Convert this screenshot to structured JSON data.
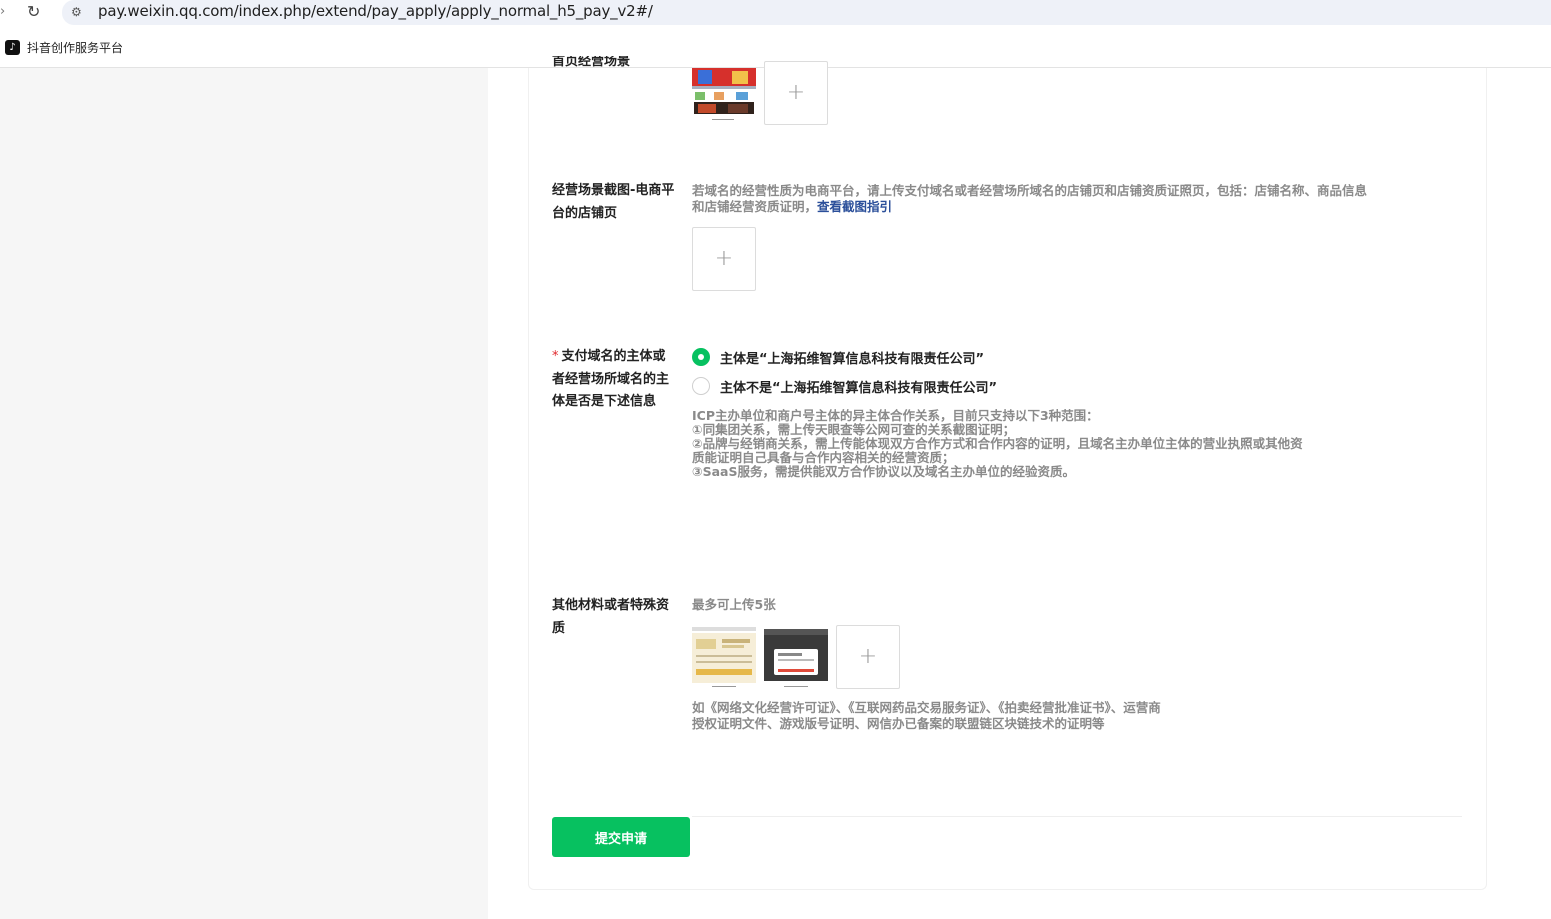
{
  "browser": {
    "url": "pay.weixin.qq.com/index.php/extend/pay_apply/apply_normal_h5_pay_v2#/",
    "bookmark": "抖音创作服务平台"
  },
  "form": {
    "top_row": {
      "label": "首页经营场景"
    },
    "shop_page": {
      "label": "经营场景截图-电商平台的店铺页",
      "hint_text": "若域名的经营性质为电商平台，请上传支付域名或者经营场所域名的店铺页和店铺资质证照页，包括：店铺名称、商品信息和店铺经营资质证明，",
      "hint_link": "查看截图指引"
    },
    "subject": {
      "required_mark": "*",
      "label": "支付域名的主体或者经营场所域名的主体是否是下述信息",
      "options": [
        {
          "label": "主体是“上海拓维智算信息科技有限责任公司”",
          "checked": true
        },
        {
          "label": "主体不是“上海拓维智算信息科技有限责任公司”",
          "checked": false
        }
      ],
      "note_lines": [
        "ICP主办单位和商户号主体的异主体合作关系，目前只支持以下3种范围：",
        "①同集团关系，需上传天眼查等公网可查的关系截图证明；",
        "②品牌与经销商关系，需上传能体现双方合作方式和合作内容的证明，且域名主办单位主体的营业执照或其他资",
        "质能证明自己具备与合作内容相关的经营资质；",
        "③SaaS服务，需提供能双方合作协议以及域名主办单位的经验资质。"
      ]
    },
    "other": {
      "label": "其他材料或者特殊资质",
      "limit_hint": "最多可上传5张",
      "note_lines": [
        "如《网络文化经营许可证》、《互联网药品交易服务证》、《拍卖经营批准证书》、运营商",
        "授权证明文件、游戏版号证明、网信办已备案的联盟链区块链技术的证明等"
      ]
    },
    "upload_plus": "+",
    "submit_label": "提交申请"
  },
  "colors": {
    "primary": "#07c160",
    "link": "#2b4f9a",
    "required": "#e0282c",
    "left_background": "#f6f6f6"
  },
  "icons": [
    "back-arrow-icon",
    "reload-icon",
    "site-info-icon",
    "douyin-icon",
    "plus-icon"
  ]
}
